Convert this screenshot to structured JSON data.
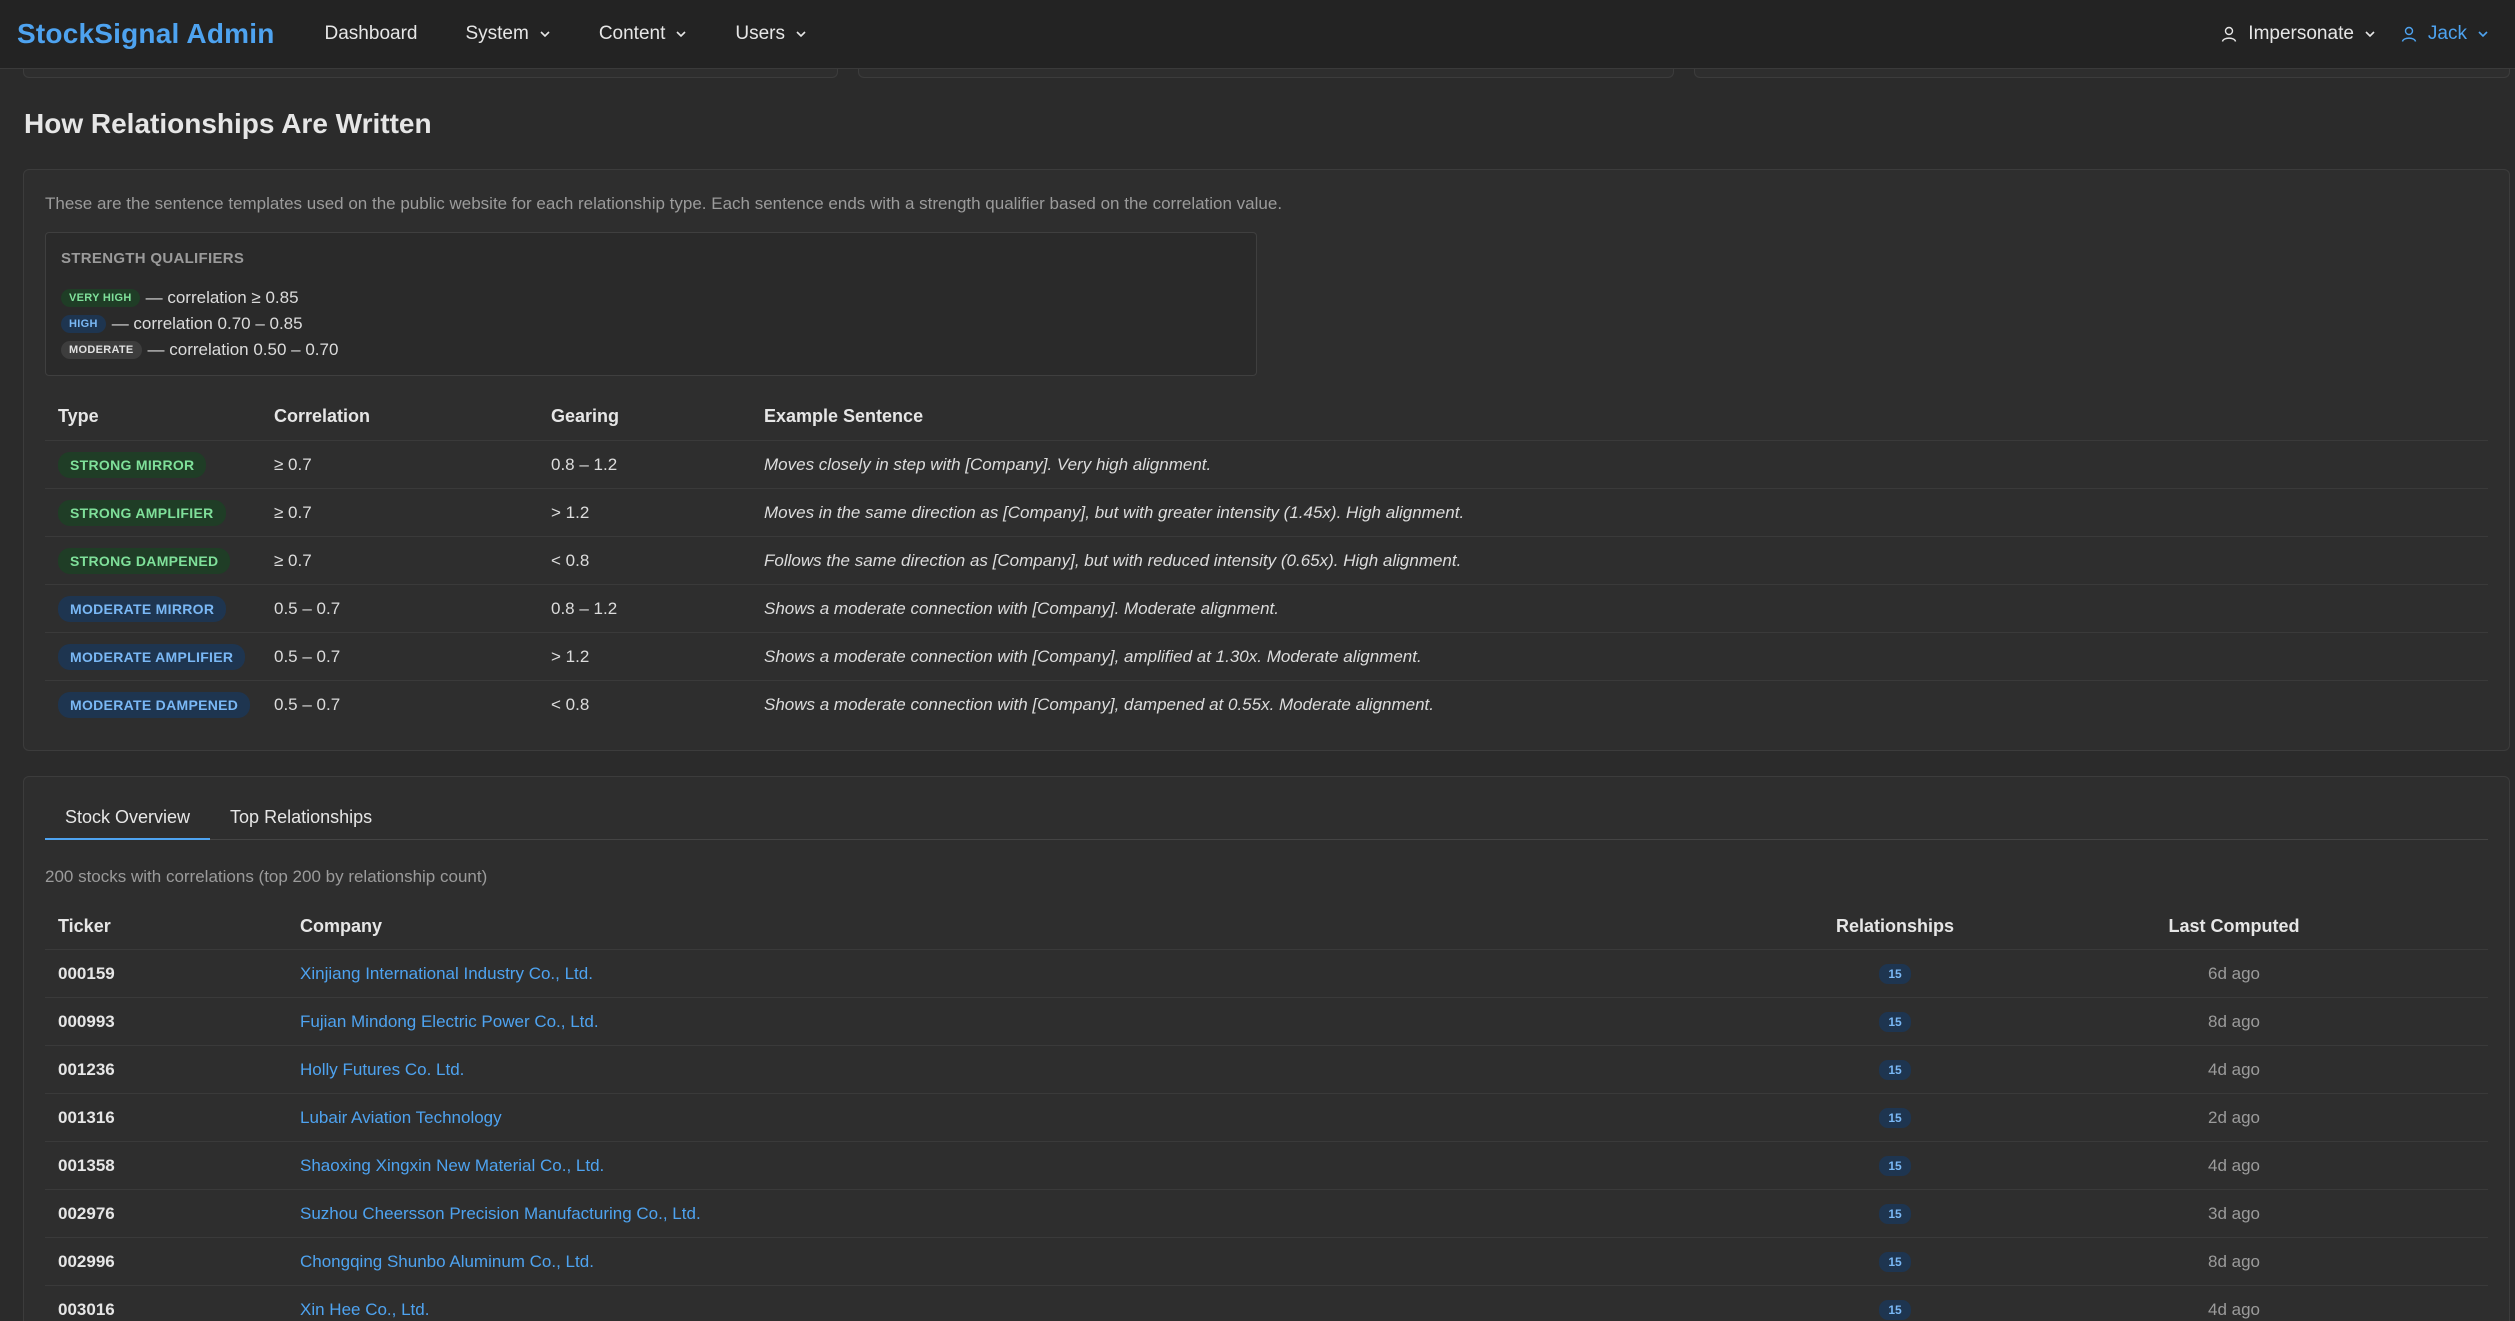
{
  "navbar": {
    "brand": "StockSignal Admin",
    "items": [
      {
        "label": "Dashboard",
        "dropdown": false
      },
      {
        "label": "System",
        "dropdown": true
      },
      {
        "label": "Content",
        "dropdown": true
      },
      {
        "label": "Users",
        "dropdown": true
      }
    ],
    "impersonate": "Impersonate",
    "user": "Jack"
  },
  "section": {
    "title": "How Relationships Are Written"
  },
  "relationships": {
    "description": "These are the sentence templates used on the public website for each relationship type. Each sentence ends with a strength qualifier based on the correlation value.",
    "qualifiers": {
      "title": "STRENGTH QUALIFIERS",
      "items": [
        {
          "badge": "VERY HIGH",
          "text": "— correlation ≥ 0.85",
          "color": "green"
        },
        {
          "badge": "HIGH",
          "text": "— correlation 0.70 – 0.85",
          "color": "blue"
        },
        {
          "badge": "MODERATE",
          "text": "— correlation 0.50 – 0.70",
          "color": "grey"
        }
      ]
    },
    "columns": [
      "Type",
      "Correlation",
      "Gearing",
      "Example Sentence"
    ],
    "rows": [
      {
        "type": "STRONG MIRROR",
        "color": "green",
        "correlation": "≥ 0.7",
        "gearing": "0.8 – 1.2",
        "example": "Moves closely in step with [Company]. Very high alignment."
      },
      {
        "type": "STRONG AMPLIFIER",
        "color": "green",
        "correlation": "≥ 0.7",
        "gearing": "> 1.2",
        "example": "Moves in the same direction as [Company], but with greater intensity (1.45x). High alignment."
      },
      {
        "type": "STRONG DAMPENED",
        "color": "green",
        "correlation": "≥ 0.7",
        "gearing": "< 0.8",
        "example": "Follows the same direction as [Company], but with reduced intensity (0.65x). High alignment."
      },
      {
        "type": "MODERATE MIRROR",
        "color": "blue",
        "correlation": "0.5 – 0.7",
        "gearing": "0.8 – 1.2",
        "example": "Shows a moderate connection with [Company]. Moderate alignment."
      },
      {
        "type": "MODERATE AMPLIFIER",
        "color": "blue",
        "correlation": "0.5 – 0.7",
        "gearing": "> 1.2",
        "example": "Shows a moderate connection with [Company], amplified at 1.30x. Moderate alignment."
      },
      {
        "type": "MODERATE DAMPENED",
        "color": "blue",
        "correlation": "0.5 – 0.7",
        "gearing": "< 0.8",
        "example": "Shows a moderate connection with [Company], dampened at 0.55x. Moderate alignment."
      }
    ]
  },
  "stocks": {
    "tabs": [
      {
        "label": "Stock Overview",
        "active": true
      },
      {
        "label": "Top Relationships",
        "active": false
      }
    ],
    "description": "200 stocks with correlations (top 200 by relationship count)",
    "columns": [
      "Ticker",
      "Company",
      "Relationships",
      "Last Computed"
    ],
    "rows": [
      {
        "ticker": "000159",
        "company": "Xinjiang International Industry Co., Ltd.",
        "relationships": "15",
        "last": "6d ago"
      },
      {
        "ticker": "000993",
        "company": "Fujian Mindong Electric Power Co., Ltd.",
        "relationships": "15",
        "last": "8d ago"
      },
      {
        "ticker": "001236",
        "company": "Holly Futures Co. Ltd.",
        "relationships": "15",
        "last": "4d ago"
      },
      {
        "ticker": "001316",
        "company": "Lubair Aviation Technology",
        "relationships": "15",
        "last": "2d ago"
      },
      {
        "ticker": "001358",
        "company": "Shaoxing Xingxin New Material Co., Ltd.",
        "relationships": "15",
        "last": "4d ago"
      },
      {
        "ticker": "002976",
        "company": "Suzhou Cheersson Precision Manufacturing Co., Ltd.",
        "relationships": "15",
        "last": "3d ago"
      },
      {
        "ticker": "002996",
        "company": "Chongqing Shunbo Aluminum Co., Ltd.",
        "relationships": "15",
        "last": "8d ago"
      },
      {
        "ticker": "003016",
        "company": "Xin Hee Co., Ltd.",
        "relationships": "15",
        "last": "4d ago"
      }
    ]
  },
  "colors": {
    "background": "#2b2b2b",
    "navbar": "#232323",
    "accent": "#4ea3f0",
    "badge_green_bg": "#1f3d26",
    "badge_green_fg": "#7fe09a",
    "badge_blue_bg": "#1e3550",
    "badge_blue_fg": "#7ab8f5"
  },
  "icons": {
    "dropdown": "chevron-down-icon",
    "user": "user-icon"
  }
}
